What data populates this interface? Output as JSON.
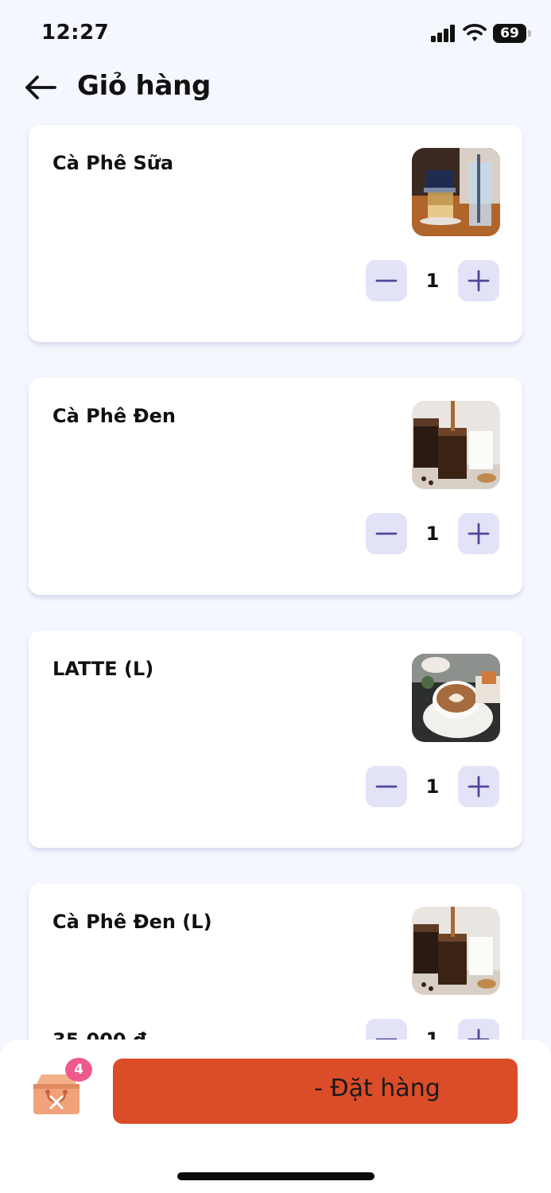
{
  "status_bar": {
    "time": "12:27",
    "battery": "69"
  },
  "header": {
    "title": "Giỏ hàng"
  },
  "cart": {
    "items": [
      {
        "name": "Cà Phê Sữa",
        "price": "",
        "quantity": "1",
        "image": "ca-phe-sua-photo"
      },
      {
        "name": "Cà Phê Đen",
        "price": "",
        "quantity": "1",
        "image": "ca-phe-den-photo"
      },
      {
        "name": "LATTE (L)",
        "price": "",
        "quantity": "1",
        "image": "latte-photo"
      },
      {
        "name": "Cà Phê Đen (L)",
        "price": "35.000 đ",
        "quantity": "1",
        "image": "ca-phe-den-photo"
      }
    ]
  },
  "bottom_bar": {
    "cart_count": "4",
    "order_label": "- Đặt hàng"
  },
  "colors": {
    "background": "#f5f7fe",
    "accent": "#db4c28",
    "qty_button": "#e3e3f8",
    "badge": "#ef5a8b",
    "qty_icon": "#4a4a9a"
  }
}
